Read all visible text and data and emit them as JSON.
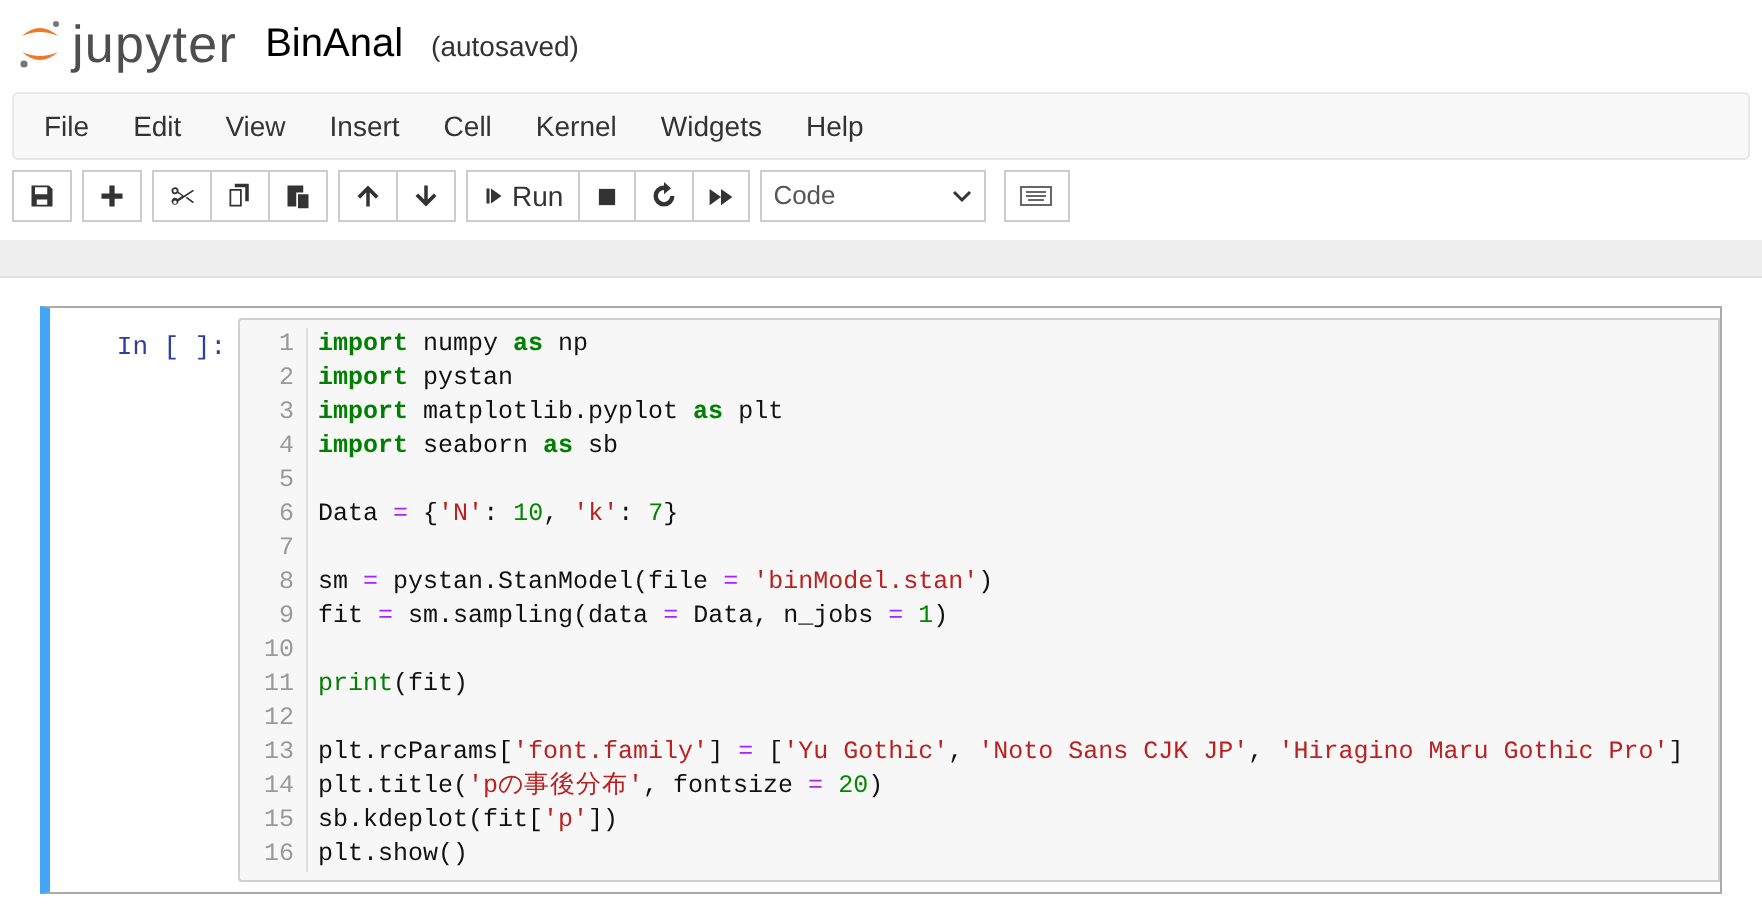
{
  "header": {
    "logo_text": "jupyter",
    "notebook_name": "BinAnal",
    "save_status": "(autosaved)"
  },
  "menu": [
    "File",
    "Edit",
    "View",
    "Insert",
    "Cell",
    "Kernel",
    "Widgets",
    "Help"
  ],
  "toolbar": {
    "run_label": "Run",
    "cell_type": "Code"
  },
  "cell": {
    "prompt": "In [ ]:",
    "selected": true,
    "lines": [
      {
        "number": "1",
        "tokens": [
          {
            "text": "import",
            "kind": "keyword"
          },
          {
            "text": " numpy ",
            "kind": "plain"
          },
          {
            "text": "as",
            "kind": "keyword"
          },
          {
            "text": " np",
            "kind": "plain"
          }
        ]
      },
      {
        "number": "2",
        "tokens": [
          {
            "text": "import",
            "kind": "keyword"
          },
          {
            "text": " pystan",
            "kind": "plain"
          }
        ]
      },
      {
        "number": "3",
        "tokens": [
          {
            "text": "import",
            "kind": "keyword"
          },
          {
            "text": " matplotlib.pyplot ",
            "kind": "plain"
          },
          {
            "text": "as",
            "kind": "keyword"
          },
          {
            "text": " plt",
            "kind": "plain"
          }
        ]
      },
      {
        "number": "4",
        "tokens": [
          {
            "text": "import",
            "kind": "keyword"
          },
          {
            "text": " seaborn ",
            "kind": "plain"
          },
          {
            "text": "as",
            "kind": "keyword"
          },
          {
            "text": " sb",
            "kind": "plain"
          }
        ]
      },
      {
        "number": "5"
      },
      {
        "number": "6",
        "tokens": [
          {
            "text": "Data ",
            "kind": "plain"
          },
          {
            "text": "=",
            "kind": "operator"
          },
          {
            "text": " {",
            "kind": "plain"
          },
          {
            "text": "'N'",
            "kind": "string"
          },
          {
            "text": ": ",
            "kind": "plain"
          },
          {
            "text": "10",
            "kind": "number"
          },
          {
            "text": ", ",
            "kind": "plain"
          },
          {
            "text": "'k'",
            "kind": "string"
          },
          {
            "text": ": ",
            "kind": "plain"
          },
          {
            "text": "7",
            "kind": "number"
          },
          {
            "text": "}",
            "kind": "plain"
          }
        ]
      },
      {
        "number": "7"
      },
      {
        "number": "8",
        "tokens": [
          {
            "text": "sm ",
            "kind": "plain"
          },
          {
            "text": "=",
            "kind": "operator"
          },
          {
            "text": " pystan.StanModel(file ",
            "kind": "plain"
          },
          {
            "text": "=",
            "kind": "operator"
          },
          {
            "text": " 'binModel.stan'",
            "kind": "string"
          },
          {
            "text": ")",
            "kind": "plain"
          }
        ]
      },
      {
        "number": "9",
        "tokens": [
          {
            "text": "fit ",
            "kind": "plain"
          },
          {
            "text": "=",
            "kind": "operator"
          },
          {
            "text": " sm.sampling(data ",
            "kind": "plain"
          },
          {
            "text": "=",
            "kind": "operator"
          },
          {
            "text": " Data, n_jobs ",
            "kind": "plain"
          },
          {
            "text": "=",
            "kind": "operator"
          },
          {
            "text": " 1",
            "kind": "number"
          },
          {
            "text": ")",
            "kind": "plain"
          }
        ]
      },
      {
        "number": "10"
      },
      {
        "number": "11",
        "tokens": [
          {
            "text": "print",
            "kind": "builtin"
          },
          {
            "text": "(fit)",
            "kind": "plain"
          }
        ]
      },
      {
        "number": "12"
      },
      {
        "number": "13",
        "tokens": [
          {
            "text": "plt.rcParams[",
            "kind": "plain"
          },
          {
            "text": "'font.family'",
            "kind": "string"
          },
          {
            "text": "] ",
            "kind": "plain"
          },
          {
            "text": "=",
            "kind": "operator"
          },
          {
            "text": " [",
            "kind": "plain"
          },
          {
            "text": "'Yu Gothic'",
            "kind": "string"
          },
          {
            "text": ", ",
            "kind": "plain"
          },
          {
            "text": "'Noto Sans CJK JP'",
            "kind": "string"
          },
          {
            "text": ", ",
            "kind": "plain"
          },
          {
            "text": "'Hiragino Maru Gothic Pro'",
            "kind": "string"
          },
          {
            "text": "]",
            "kind": "plain"
          }
        ]
      },
      {
        "number": "14",
        "tokens": [
          {
            "text": "plt.title(",
            "kind": "plain"
          },
          {
            "text": "'pの事後分布'",
            "kind": "string"
          },
          {
            "text": ", fontsize ",
            "kind": "plain"
          },
          {
            "text": "=",
            "kind": "operator"
          },
          {
            "text": " 20",
            "kind": "number"
          },
          {
            "text": ")",
            "kind": "plain"
          }
        ]
      },
      {
        "number": "15",
        "tokens": [
          {
            "text": "sb.kdeplot(fit[",
            "kind": "plain"
          },
          {
            "text": "'p'",
            "kind": "string"
          },
          {
            "text": "])",
            "kind": "plain"
          }
        ]
      },
      {
        "number": "16",
        "tokens": [
          {
            "text": "plt.show()",
            "kind": "plain"
          }
        ]
      }
    ]
  }
}
